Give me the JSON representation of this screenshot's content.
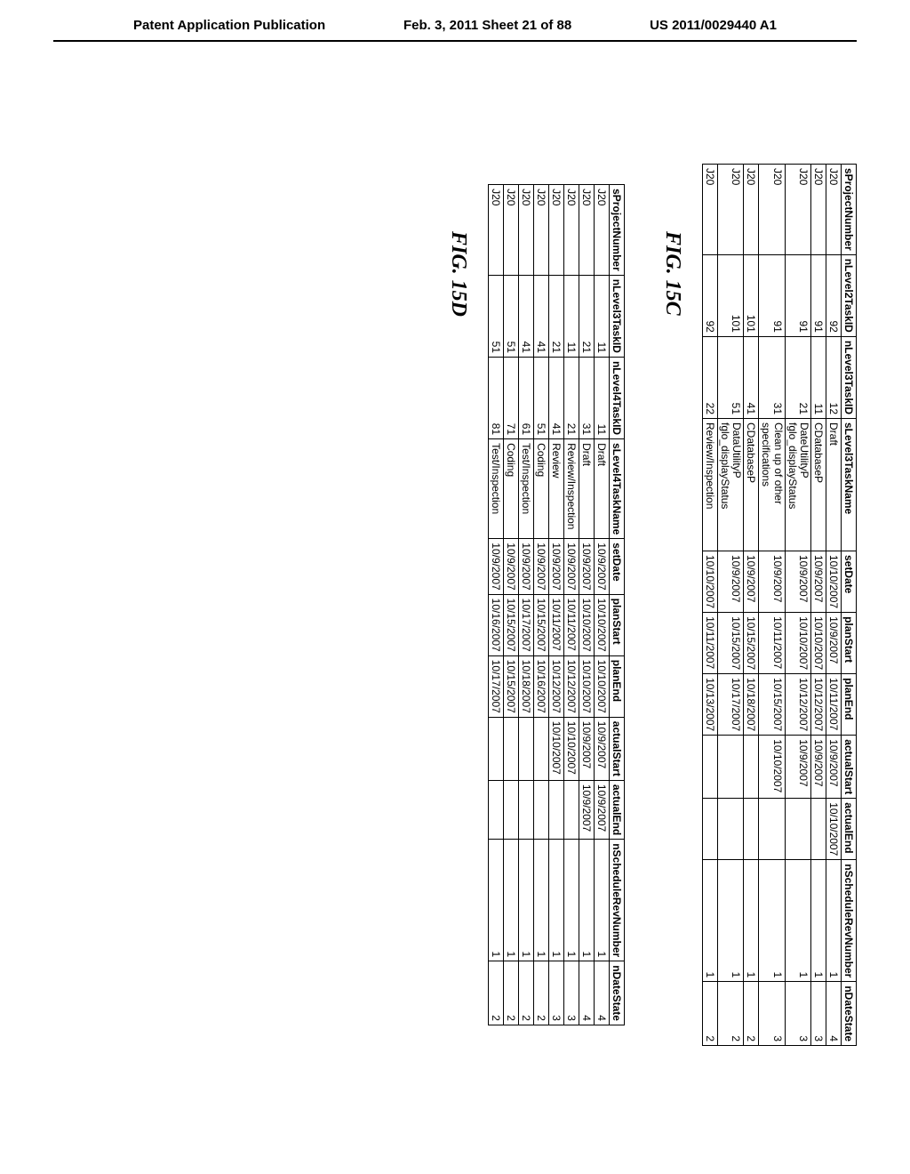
{
  "header": {
    "left": "Patent Application Publication",
    "center": "Feb. 3, 2011  Sheet 21 of 88",
    "right": "US 2011/0029440 A1"
  },
  "figC": {
    "label": "FIG. 15C",
    "columns": [
      "sProjectNumber",
      "nLevel2TaskID",
      "nLevel3TaskID",
      "sLevel3TaskName",
      "setDate",
      "planStart",
      "planEnd",
      "actualStart",
      "actualEnd",
      "nScheduleRevNumber",
      "nDateState"
    ],
    "rows": [
      {
        "c0": "J20",
        "c1": "92",
        "c2": "12",
        "c3": "Draft",
        "c4": "10/10/2007",
        "c5": "10/9/2007",
        "c6": "10/11/2007",
        "c7": "10/9/2007",
        "c8": "10/10/2007",
        "c9": "1",
        "c10": "4"
      },
      {
        "c0": "J20",
        "c1": "91",
        "c2": "11",
        "c3": "CDatabaseP",
        "c4": "10/9/2007",
        "c5": "10/10/2007",
        "c6": "10/12/2007",
        "c7": "10/9/2007",
        "c8": "",
        "c9": "1",
        "c10": "3"
      },
      {
        "c0": "J20",
        "c1": "91",
        "c2": "21",
        "c3": "DateUtilityP\nfglo_displayStatus",
        "c4": "10/9/2007",
        "c5": "10/10/2007",
        "c6": "10/12/2007",
        "c7": "10/9/2007",
        "c8": "",
        "c9": "1",
        "c10": "3"
      },
      {
        "c0": "J20",
        "c1": "91",
        "c2": "31",
        "c3": "Clean up of other specifications",
        "c4": "10/9/2007",
        "c5": "10/11/2007",
        "c6": "10/15/2007",
        "c7": "10/10/2007",
        "c8": "",
        "c9": "1",
        "c10": "3"
      },
      {
        "c0": "J20",
        "c1": "101",
        "c2": "41",
        "c3": "CDatabaseP",
        "c4": "10/9/2007",
        "c5": "10/15/2007",
        "c6": "10/18/2007",
        "c7": "",
        "c8": "",
        "c9": "1",
        "c10": "2"
      },
      {
        "c0": "J20",
        "c1": "101",
        "c2": "51",
        "c3": "DataUtilityP\nfglo_displayStatus",
        "c4": "10/9/2007",
        "c5": "10/15/2007",
        "c6": "10/17/2007",
        "c7": "",
        "c8": "",
        "c9": "1",
        "c10": "2"
      },
      {
        "c0": "J20",
        "c1": "92",
        "c2": "22",
        "c3": "Review/Inspection",
        "c4": "10/10/2007",
        "c5": "10/11/2007",
        "c6": "10/13/2007",
        "c7": "",
        "c8": "",
        "c9": "1",
        "c10": "2"
      }
    ]
  },
  "figD": {
    "label": "FIG. 15D",
    "columns": [
      "sProjectNumber",
      "nLevel3TaskID",
      "nLevel4TaskID",
      "sLevel4TaskName",
      "setDate",
      "planStart",
      "planEnd",
      "actualStart",
      "actualEnd",
      "nScheduleRevNumber",
      "nDateState"
    ],
    "rows": [
      {
        "c0": "J20",
        "c1": "11",
        "c2": "11",
        "c3": "Draft",
        "c4": "10/9/2007",
        "c5": "10/10/2007",
        "c6": "10/10/2007",
        "c7": "10/9/2007",
        "c8": "10/9/2007",
        "c9": "1",
        "c10": "4"
      },
      {
        "c0": "J20",
        "c1": "21",
        "c2": "31",
        "c3": "Draft",
        "c4": "10/9/2007",
        "c5": "10/10/2007",
        "c6": "10/10/2007",
        "c7": "10/9/2007",
        "c8": "10/9/2007",
        "c9": "1",
        "c10": "4"
      },
      {
        "c0": "J20",
        "c1": "11",
        "c2": "21",
        "c3": "Review/Inspection",
        "c4": "10/9/2007",
        "c5": "10/11/2007",
        "c6": "10/12/2007",
        "c7": "10/10/2007",
        "c8": "",
        "c9": "1",
        "c10": "3"
      },
      {
        "c0": "J20",
        "c1": "21",
        "c2": "41",
        "c3": "Review",
        "c4": "10/9/2007",
        "c5": "10/11/2007",
        "c6": "10/12/2007",
        "c7": "10/10/2007",
        "c8": "",
        "c9": "1",
        "c10": "3"
      },
      {
        "c0": "J20",
        "c1": "41",
        "c2": "51",
        "c3": "Coding",
        "c4": "10/9/2007",
        "c5": "10/15/2007",
        "c6": "10/16/2007",
        "c7": "",
        "c8": "",
        "c9": "1",
        "c10": "2"
      },
      {
        "c0": "J20",
        "c1": "41",
        "c2": "61",
        "c3": "Test/Inspection",
        "c4": "10/9/2007",
        "c5": "10/17/2007",
        "c6": "10/18/2007",
        "c7": "",
        "c8": "",
        "c9": "1",
        "c10": "2"
      },
      {
        "c0": "J20",
        "c1": "51",
        "c2": "71",
        "c3": "Coding",
        "c4": "10/9/2007",
        "c5": "10/15/2007",
        "c6": "10/15/2007",
        "c7": "",
        "c8": "",
        "c9": "1",
        "c10": "2"
      },
      {
        "c0": "J20",
        "c1": "51",
        "c2": "81",
        "c3": "Test/Inspection",
        "c4": "10/9/2007",
        "c5": "10/16/2007",
        "c6": "10/17/2007",
        "c7": "",
        "c8": "",
        "c9": "1",
        "c10": "2"
      }
    ]
  }
}
